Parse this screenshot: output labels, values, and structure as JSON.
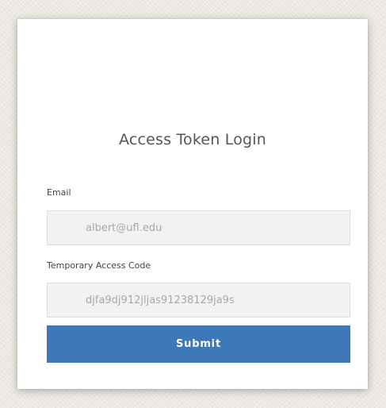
{
  "login": {
    "title": "Access Token Login",
    "email_label": "Email",
    "email_value": "albert@ufl.edu",
    "code_label": "Temporary Access Code",
    "code_value": "djfa9dj912jljas91238129ja9s",
    "submit_label": "Submit"
  },
  "colors": {
    "submit_button": "#3d79b8",
    "input_background": "#f2f2f2",
    "page_background": "#ece9e2"
  }
}
